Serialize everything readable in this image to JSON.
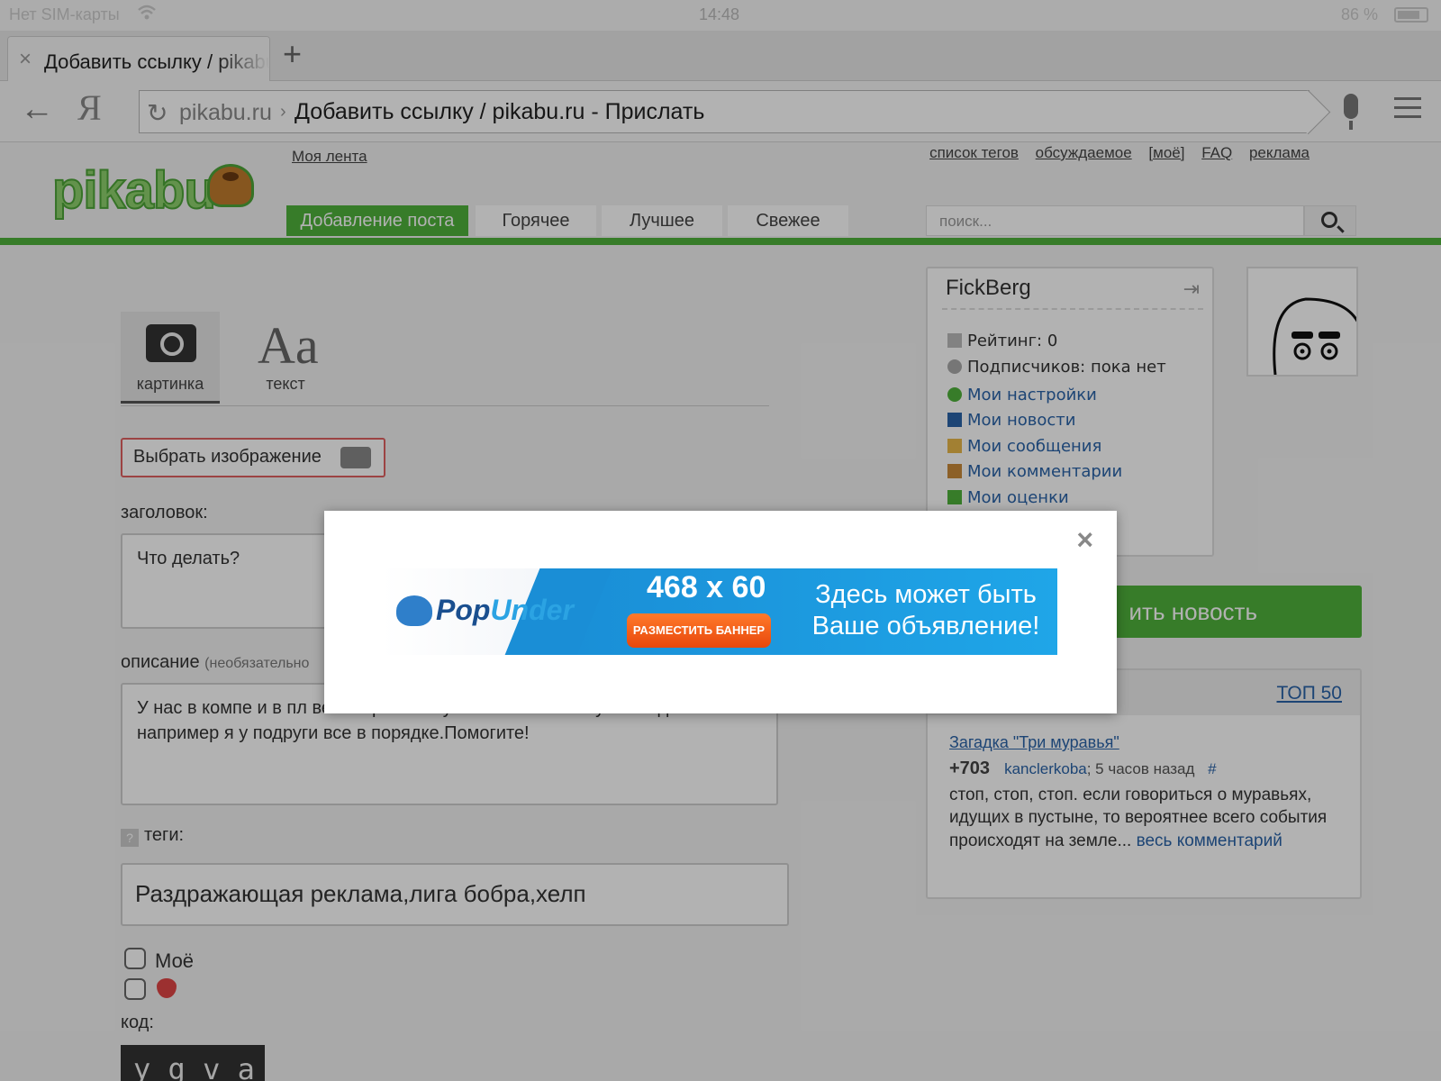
{
  "status": {
    "carrier": "Нет SIM-карты",
    "time": "14:48",
    "battery": "86 %"
  },
  "tab": {
    "title": "Добавить ссылку / pikabu.ru - Прислать",
    "close": "×",
    "new_tab": "+"
  },
  "address": {
    "host": "pikabu.ru",
    "separator": "›",
    "page_title": "Добавить ссылку / pikabu.ru - Прислать",
    "back": "←",
    "yandex": "Я",
    "reload": "↻"
  },
  "site": {
    "logo": "pikabu",
    "my_feed": "Моя лента",
    "top_links": [
      "список тегов",
      "обсуждаемое",
      "[моё]",
      "FAQ",
      "реклама"
    ],
    "nav_tabs": [
      "Добавление поста",
      "Горячее",
      "Лучшее",
      "Свежее"
    ],
    "search_placeholder": "поиск..."
  },
  "form": {
    "type_tabs": [
      "картинка",
      "текст"
    ],
    "text_icon": "Aa",
    "choose_image": "Выбрать изображение",
    "title_label": "заголовок:",
    "title_value": "Что делать?",
    "desc_label": "описание",
    "desc_hint": "(необязательно",
    "desc_value": "У нас в компе и в пл                                                               весь экран.Это у всех кто бывает у нас в доме.Если например я у подруги все в порядке.Помогите!",
    "tags_help": "?",
    "tags_label": "теги:",
    "tags_value": "Раздражающая реклама,лига бобра,хелп",
    "checkbox_mine": "Моё",
    "code_label": "код:",
    "captcha": "y g v a"
  },
  "sidebar": {
    "username": "FickBerg",
    "rating": "Рейтинг: 0",
    "subscribers": "Подписчиков: пока нет",
    "links": [
      "Мои настройки",
      "Мои новости",
      "Мои сообщения",
      "Мои комментарии",
      "Мои оценки"
    ],
    "green_button": "ить новость",
    "top50": "ТОП 50",
    "post": {
      "title": "Загадка \"Три муравья\"",
      "score": "+703",
      "author": "kanclerkoba",
      "time": "; 5 часов назад",
      "hash": "#",
      "body": "стоп, стоп, стоп. если говориться о муравьях, идущих в пустыне, то вероятнее всего события происходят на земле...",
      "more": "весь комментарий"
    }
  },
  "ad": {
    "close": "×",
    "brand_pop": "Pop",
    "brand_under": "Under",
    "size": "468 x 60",
    "cta": "РАЗМЕСТИТЬ БАННЕР",
    "slogan": "Здесь может быть Ваше объявление!"
  },
  "watermark": "pikabu.ru",
  "colors": {
    "accent_green": "#4fb23c",
    "link_blue": "#2a63a8",
    "cta_orange": "#e8470c",
    "banner_blue": "#1a8ed6"
  }
}
